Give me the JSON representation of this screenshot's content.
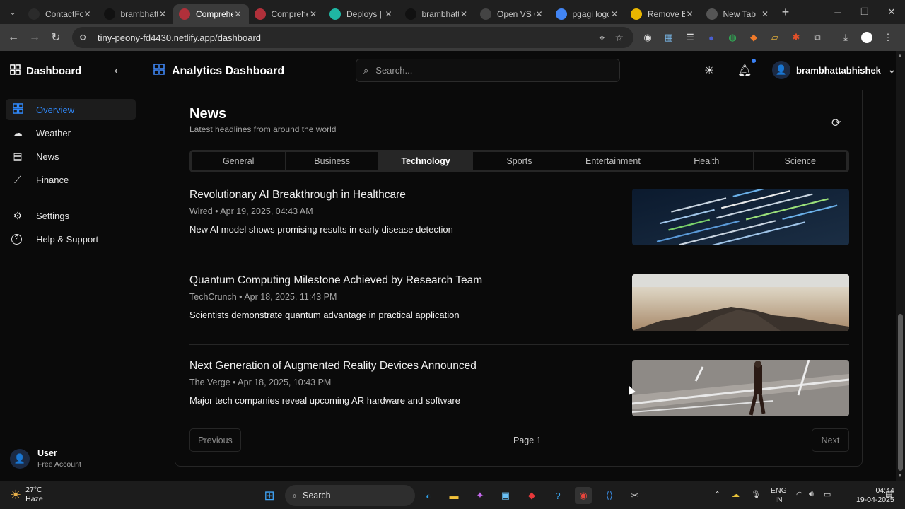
{
  "browser": {
    "tabs": [
      {
        "title": "ContactFo",
        "icon": "globe-dark-icon",
        "color": "#2b2b2b",
        "active": false
      },
      {
        "title": "brambhatt",
        "icon": "github-icon",
        "color": "#111111",
        "active": false
      },
      {
        "title": "Comprehe",
        "icon": "app-logo-icon",
        "color": "#b0303a",
        "active": true
      },
      {
        "title": "Comprehe",
        "icon": "app-logo-icon",
        "color": "#b0303a",
        "active": false
      },
      {
        "title": "Deploys | t",
        "icon": "netlify-icon",
        "color": "#1fb6a3",
        "active": false
      },
      {
        "title": "brambhatt",
        "icon": "github-icon",
        "color": "#111111",
        "active": false
      },
      {
        "title": "Open VS C",
        "icon": "openvsx-icon",
        "color": "#444444",
        "active": false
      },
      {
        "title": "pgagi logo",
        "icon": "google-icon",
        "color": "#4285f4",
        "active": false
      },
      {
        "title": "Remove B",
        "icon": "removebg-icon",
        "color": "#e9b600",
        "active": false
      },
      {
        "title": "New Tab",
        "icon": "chrome-icon",
        "color": "#555555",
        "active": false
      }
    ],
    "url": "tiny-peony-fd4430.netlify.app/dashboard"
  },
  "sidebar": {
    "title": "Dashboard",
    "items": [
      {
        "label": "Overview",
        "icon": "grid-icon",
        "active": true
      },
      {
        "label": "Weather",
        "icon": "cloud-icon",
        "active": false
      },
      {
        "label": "News",
        "icon": "newspaper-icon",
        "active": false
      },
      {
        "label": "Finance",
        "icon": "chart-line-icon",
        "active": false
      },
      {
        "label": "Settings",
        "icon": "gear-icon",
        "active": false
      },
      {
        "label": "Help & Support",
        "icon": "help-circle-icon",
        "active": false
      }
    ],
    "user": {
      "name": "User",
      "plan": "Free Account"
    }
  },
  "header": {
    "title": "Analytics Dashboard",
    "search_placeholder": "Search...",
    "username": "brambhattabhishek"
  },
  "news": {
    "title": "News",
    "subtitle": "Latest headlines from around the world",
    "categories": [
      "General",
      "Business",
      "Technology",
      "Sports",
      "Entertainment",
      "Health",
      "Science"
    ],
    "active_category": "Technology",
    "articles": [
      {
        "title": "Revolutionary AI Breakthrough in Healthcare",
        "meta": "Wired • Apr 19, 2025, 04:43 AM",
        "description": "New AI model shows promising results in early disease detection",
        "image": "code-screen-photo"
      },
      {
        "title": "Quantum Computing Milestone Achieved by Research Team",
        "meta": "TechCrunch • Apr 18, 2025, 11:43 PM",
        "description": "Scientists demonstrate quantum advantage in practical application",
        "image": "rocky-beach-photo"
      },
      {
        "title": "Next Generation of Augmented Reality Devices Announced",
        "meta": "The Verge • Apr 18, 2025, 10:43 PM",
        "description": "Major tech companies reveal upcoming AR hardware and software",
        "image": "man-walking-road-photo"
      }
    ],
    "pagination": {
      "previous": "Previous",
      "page": "Page 1",
      "next": "Next"
    }
  },
  "taskbar": {
    "weather_temp": "27°C",
    "weather_desc": "Haze",
    "search_label": "Search",
    "lang_line1": "ENG",
    "lang_line2": "IN",
    "time": "04:44",
    "date": "19-04-2025"
  },
  "colors": {
    "accent": "#2f86f6",
    "background": "#0a0a0a",
    "border": "#262626"
  }
}
